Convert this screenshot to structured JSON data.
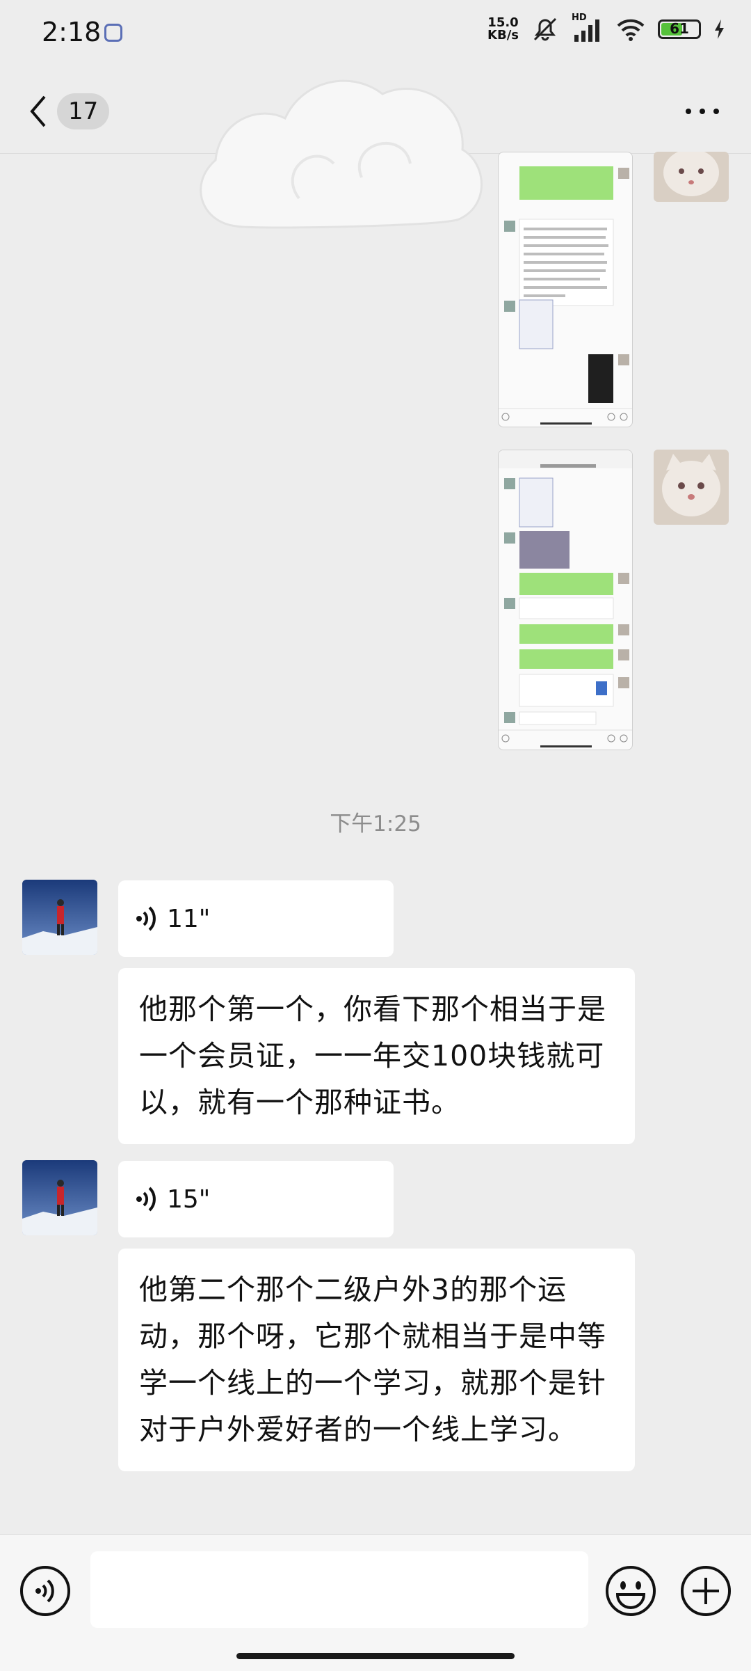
{
  "status_bar": {
    "time": "2:18",
    "net_speed_value": "15.0",
    "net_speed_unit": "KB/s",
    "hd_label": "HD",
    "battery_level": "61",
    "battery_fraction": 0.61
  },
  "nav": {
    "unread_count": "17"
  },
  "chat": {
    "timestamp": "下午1:25",
    "messages": [
      {
        "type": "voice",
        "duration": "11\""
      },
      {
        "type": "text",
        "text": "他那个第一个，你看下那个相当于是一个会员证，一一年交100块钱就可以，就有一个那种证书。"
      },
      {
        "type": "voice",
        "duration": "15\""
      },
      {
        "type": "text",
        "text": "他第二个那个二级户外3的那个运动，那个呀，它那个就相当于是中等学一个线上的一个学习，就那个是针对于户外爱好者的一个线上学习。"
      }
    ]
  },
  "colors": {
    "chat_bg": "#ededed",
    "bubble_bg": "#ffffff",
    "wechat_green": "#95ec69",
    "battery_green": "#56c23b"
  }
}
